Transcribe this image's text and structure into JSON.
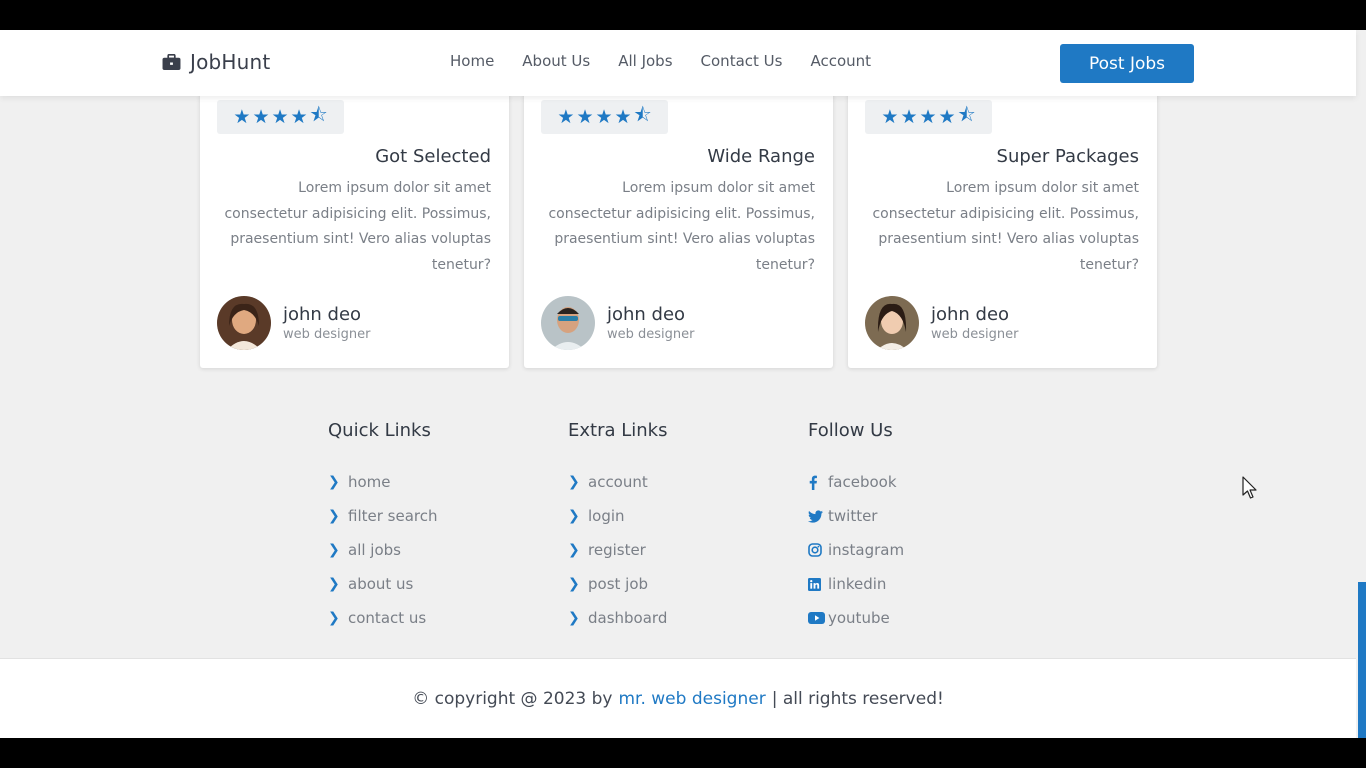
{
  "header": {
    "brand": "JobHunt",
    "nav": [
      "Home",
      "About Us",
      "All Jobs",
      "Contact Us",
      "Account"
    ],
    "cta": "Post Jobs"
  },
  "reviews": [
    {
      "title": "Got Selected",
      "text": "Lorem ipsum dolor sit amet consectetur adipisicing elit. Possimus, praesentium sint! Vero alias voluptas tenetur?",
      "name": "john deo",
      "role": "web designer",
      "rating": 4.5
    },
    {
      "title": "Wide Range",
      "text": "Lorem ipsum dolor sit amet consectetur adipisicing elit. Possimus, praesentium sint! Vero alias voluptas tenetur?",
      "name": "john deo",
      "role": "web designer",
      "rating": 4.5
    },
    {
      "title": "Super Packages",
      "text": "Lorem ipsum dolor sit amet consectetur adipisicing elit. Possimus, praesentium sint! Vero alias voluptas tenetur?",
      "name": "john deo",
      "role": "web designer",
      "rating": 4.5
    }
  ],
  "footer": {
    "quick": {
      "title": "Quick Links",
      "items": [
        "home",
        "filter search",
        "all jobs",
        "about us",
        "contact us"
      ]
    },
    "extra": {
      "title": "Extra Links",
      "items": [
        "account",
        "login",
        "register",
        "post job",
        "dashboard"
      ]
    },
    "follow": {
      "title": "Follow Us",
      "items": [
        "facebook",
        "twitter",
        "instagram",
        "linkedin",
        "youtube"
      ]
    }
  },
  "copyright": {
    "prefix": "© copyright @ 2023 by",
    "author": "mr. web designer",
    "suffix": "| all rights reserved!"
  },
  "colors": {
    "accent": "#1f79c4"
  }
}
